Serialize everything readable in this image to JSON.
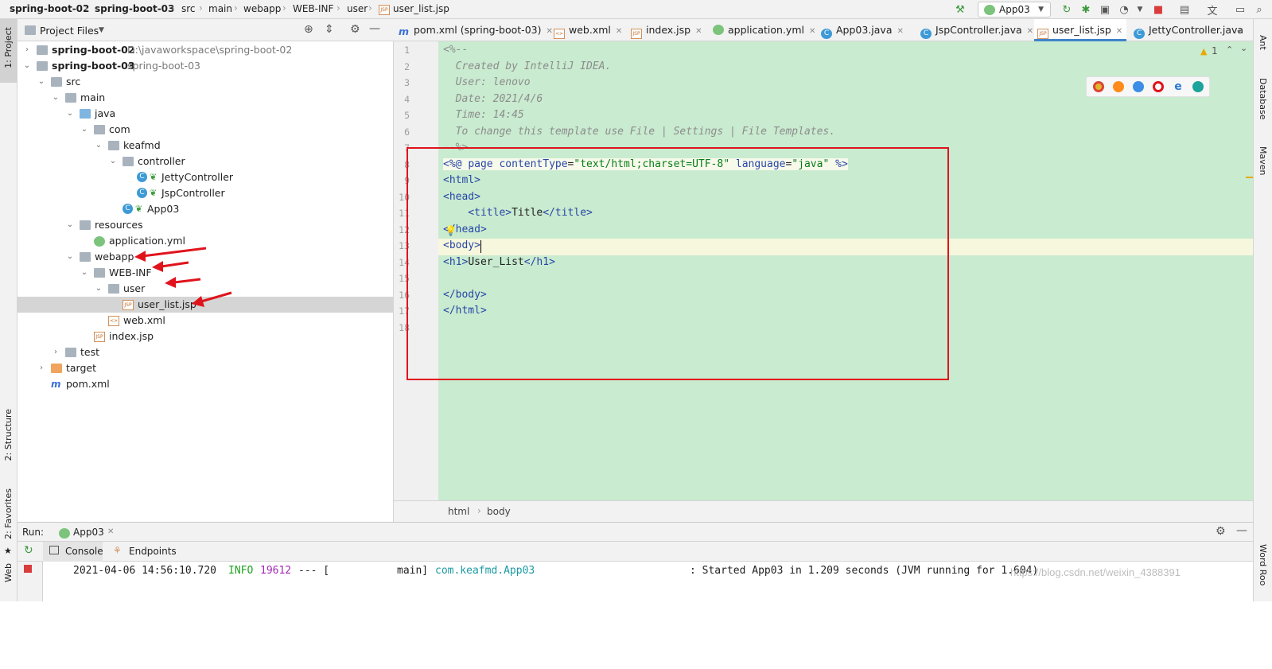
{
  "breadcrumbs": [
    "spring-boot-02",
    "spring-boot-03",
    "src",
    "main",
    "webapp",
    "WEB-INF",
    "user",
    "user_list.jsp"
  ],
  "toolbar": {
    "run_config": "App03"
  },
  "left_strip": {
    "project": "1: Project",
    "structure": "2: Structure",
    "favorites": "2: Favorites",
    "web": "Web"
  },
  "right_strip": {
    "ant": "Ant",
    "database": "Database",
    "maven": "Maven",
    "word": "Word Roo"
  },
  "project_panel": {
    "title": "Project Files",
    "tree": [
      {
        "label": "spring-boot-02",
        "sub": "D:\\javaworkspace\\spring-boot-02"
      },
      {
        "label": "spring-boot-03",
        "sub": "spring-boot-03"
      },
      {
        "label": "src"
      },
      {
        "label": "main"
      },
      {
        "label": "java"
      },
      {
        "label": "com"
      },
      {
        "label": "keafmd"
      },
      {
        "label": "controller"
      },
      {
        "label": "JettyController"
      },
      {
        "label": "JspController"
      },
      {
        "label": "App03"
      },
      {
        "label": "resources"
      },
      {
        "label": "application.yml"
      },
      {
        "label": "webapp"
      },
      {
        "label": "WEB-INF"
      },
      {
        "label": "user"
      },
      {
        "label": "user_list.jsp"
      },
      {
        "label": "web.xml"
      },
      {
        "label": "index.jsp"
      },
      {
        "label": "test"
      },
      {
        "label": "target"
      },
      {
        "label": "pom.xml"
      }
    ]
  },
  "tabs": [
    {
      "label": "pom.xml (spring-boot-03)"
    },
    {
      "label": "web.xml"
    },
    {
      "label": "index.jsp"
    },
    {
      "label": "application.yml"
    },
    {
      "label": "App03.java"
    },
    {
      "label": "JspController.java"
    },
    {
      "label": "user_list.jsp"
    },
    {
      "label": "JettyController.java"
    }
  ],
  "editor": {
    "warning_count": "1",
    "line_numbers": [
      "1",
      "2",
      "3",
      "4",
      "5",
      "6",
      "7",
      "8",
      "9",
      "10",
      "11",
      "12",
      "13",
      "14",
      "15",
      "16",
      "17",
      "18"
    ],
    "lines": {
      "l1": "<%--",
      "l2": "  Created by IntelliJ IDEA.",
      "l3": "  User: lenovo",
      "l4": "  Date: 2021/4/6",
      "l5": "  Time: 14:45",
      "l6": "  To change this template use File | Settings | File Templates.",
      "l7": "--%>",
      "l8_a": "<%@ ",
      "l8_b": "page ",
      "l8_c": "contentType",
      "l8_d": "=",
      "l8_e": "\"text/html;charset=UTF-8\"",
      "l8_f": " language",
      "l8_g": "=",
      "l8_h": "\"java\"",
      "l8_i": " %>",
      "l9": "<html>",
      "l10": "<head>",
      "l11_a": "    <title>",
      "l11_b": "Title",
      "l11_c": "</title>",
      "l12": "</head>",
      "l13": "<body>",
      "l14_a": "<h1>",
      "l14_b": "User_List",
      "l14_c": "</h1>",
      "l16": "</body>",
      "l17": "</html>"
    },
    "breadcrumb": [
      "html",
      "body"
    ]
  },
  "run_panel": {
    "label": "Run:",
    "config": "App03",
    "tabs": [
      "Console",
      "Endpoints"
    ],
    "log": {
      "timestamp": "2021-04-06 14:56:10.720",
      "level": "INFO",
      "pid": "19612",
      "sep": "--- [",
      "thread": "main]",
      "logger": "com.keafmd.App03",
      "message": ": Started App03 in 1.209 seconds (JVM running for 1.604)"
    },
    "watermark": "https://blog.csdn.net/weixin_4388391"
  },
  "colors": {
    "accent": "#4083c9",
    "editor_bg": "#c9ebd0",
    "annotation": "#e0131c"
  }
}
